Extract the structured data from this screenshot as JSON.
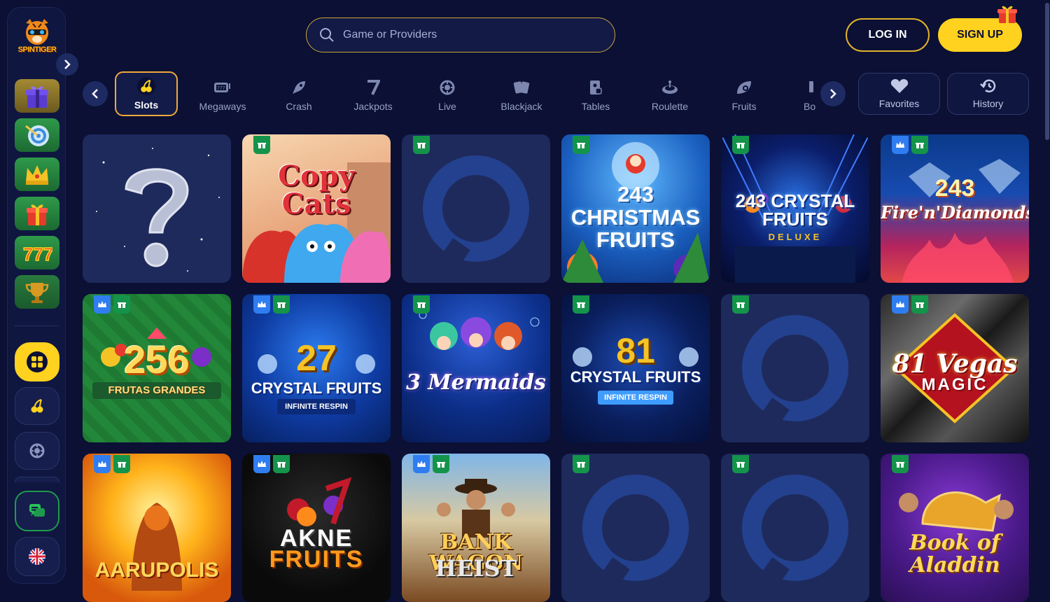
{
  "brand": {
    "name": "SPINTIGER"
  },
  "search": {
    "placeholder": "Game or Providers"
  },
  "header": {
    "login_label": "LOG IN",
    "signup_label": "SIGN UP"
  },
  "categories": [
    {
      "label": "Slots",
      "icon": "cherry-icon",
      "active": true
    },
    {
      "label": "Megaways",
      "icon": "slot-machine-icon"
    },
    {
      "label": "Crash",
      "icon": "rocket-icon"
    },
    {
      "label": "Jackpots",
      "icon": "seven-icon"
    },
    {
      "label": "Live",
      "icon": "chip-icon"
    },
    {
      "label": "Blackjack",
      "icon": "cards-icon"
    },
    {
      "label": "Tables",
      "icon": "table-cards-icon"
    },
    {
      "label": "Roulette",
      "icon": "roulette-icon"
    },
    {
      "label": "Fruits",
      "icon": "fruits-icon"
    },
    {
      "label": "Bo",
      "icon": "bonus-icon"
    }
  ],
  "quick_links": {
    "favorites_label": "Favorites",
    "history_label": "History"
  },
  "games": [
    {
      "title": "",
      "type": "mystery",
      "badges": []
    },
    {
      "title": "Copy Cats",
      "type": "art",
      "badges": [
        "gift"
      ]
    },
    {
      "title": "",
      "type": "placeholder",
      "badges": [
        "gift"
      ]
    },
    {
      "title": "243 CHRISTMAS FRUITS",
      "type": "art",
      "badges": [
        "gift"
      ]
    },
    {
      "title": "243 CRYSTAL FRUITS",
      "subtitle": "DELUXE",
      "type": "art",
      "badges": [
        "gift"
      ]
    },
    {
      "title": "243 Fire'n'Diamonds",
      "type": "art",
      "badges": [
        "crown",
        "gift"
      ]
    },
    {
      "title": "256",
      "subtitle": "FRUTAS GRANDES",
      "type": "art",
      "badges": [
        "crown",
        "gift"
      ]
    },
    {
      "title": "27",
      "subtitle": "CRYSTAL FRUITS",
      "tag": "INFINITE RESPIN",
      "type": "art",
      "badges": [
        "crown",
        "gift"
      ]
    },
    {
      "title": "3 Mermaids",
      "type": "art",
      "badges": [
        "gift"
      ]
    },
    {
      "title": "81",
      "subtitle": "CRYSTAL FRUITS",
      "tag": "INFINITE RESPIN",
      "type": "art",
      "badges": [
        "gift"
      ]
    },
    {
      "title": "",
      "type": "placeholder",
      "badges": [
        "gift"
      ]
    },
    {
      "title": "81 Vegas",
      "subtitle": "MAGIC",
      "type": "art",
      "badges": [
        "crown",
        "gift"
      ]
    },
    {
      "title": "AARUPOLIS",
      "type": "art",
      "badges": [
        "crown",
        "gift"
      ]
    },
    {
      "title": "AKNE",
      "subtitle": "FRUITS",
      "type": "art",
      "badges": [
        "crown",
        "gift"
      ]
    },
    {
      "title": "BANK WAGON",
      "subtitle": "HEIST",
      "type": "art",
      "badges": [
        "crown",
        "gift"
      ]
    },
    {
      "title": "",
      "type": "placeholder",
      "badges": [
        "gift"
      ]
    },
    {
      "title": "",
      "type": "placeholder",
      "badges": [
        "gift"
      ]
    },
    {
      "title": "Book of Aladdin",
      "type": "art",
      "badges": [
        "gift"
      ]
    }
  ],
  "colors": {
    "background": "#0b1034",
    "accent": "#ffd21f",
    "gift_badge": "#14944a",
    "crown_badge": "#2f7df0"
  }
}
